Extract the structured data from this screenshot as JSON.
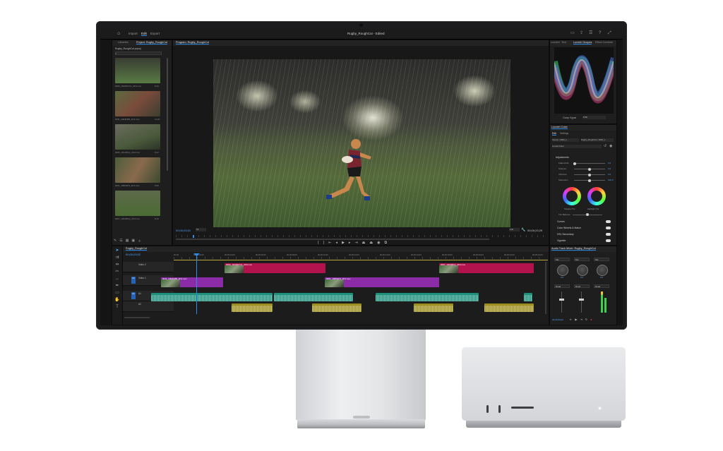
{
  "app": {
    "title": "Rugby_RoughCut - Edited",
    "menu": [
      "Import",
      "Edit",
      "Export"
    ],
    "active_menu": "Edit"
  },
  "project_panel": {
    "tabs": [
      "Libraries",
      "Project: Rugby_RoughCut"
    ],
    "breadcrumb": "Rugby_RoughCut.prproj",
    "clips": [
      {
        "name": "0003_19HM07C1_4K3.mov",
        "duration": "5;24"
      },
      {
        "name": "0011_10EZHB5_4K3.mov",
        "duration": "11;20"
      },
      {
        "name": "0005_15C20KQ_4K3.mov",
        "duration": "6;12"
      },
      {
        "name": "0001_19B7EP3_4K3.mov",
        "duration": "5;06"
      },
      {
        "name": "0007_10D28KQ_4K3.mov",
        "duration": "8;19"
      }
    ]
  },
  "program_monitor": {
    "tab": "Program: Rugby_RoughCut",
    "timecode_in": "00;00;03;02",
    "timecode_out": "00;00;23;29",
    "zoom": "Fit",
    "quality": "Full"
  },
  "timeline": {
    "tab": "Rugby_RoughCut",
    "timecode": "00;00;03;02",
    "ruler": [
      "00;00",
      "00;00;02;00",
      "00;00;04;00",
      "00;00;06;00",
      "00;00;08;00",
      "00;00;10;00",
      "00;00;12;00",
      "00;00;14;00",
      "00;00;16;00",
      "00;00;18;00",
      "00;00;20;00",
      "00;00;22;00",
      "00;00;24;00"
    ],
    "tracks": {
      "v2": "Video 2",
      "v1": "Video 1",
      "a1": "A1",
      "a2": "A2"
    },
    "clips": {
      "v2a": "0003_19HM07C1_4K3.mov",
      "v1a": "0011_10EZHB5_4K3.mov",
      "v1b": "0001_19B7EP3_4K3.mov",
      "v2b": "0007_10D28KQ_4K3.mov"
    }
  },
  "scopes_panel": {
    "tabs": [
      "Lumetri",
      "Text",
      "Lumetri Scopes",
      "Effect Controls"
    ],
    "clamp_label": "Clamp Signal",
    "bit_depth": "8 Bit"
  },
  "lumetri_color": {
    "tab": "Lumetri Color",
    "subtabs": [
      "Edit",
      "Settings"
    ],
    "source": "Source • 0003_1...",
    "target": "Rugby_RoughCut • 0003_1...",
    "preset": "Lumetri Color",
    "adjustments_label": "Adjustments",
    "sliders": [
      {
        "label": "Faded Film",
        "value": "0.0"
      },
      {
        "label": "Sharpen",
        "value": "0.0"
      },
      {
        "label": "Vibrance",
        "value": "0.0"
      },
      {
        "label": "Saturation",
        "value": "100.0"
      }
    ],
    "wheels": [
      "Shadow Tint",
      "Highlight Tint"
    ],
    "tint_balance": "Tint Balance",
    "sections": [
      "Curves",
      "Color Wheels & Match",
      "HSL Secondary",
      "Vignette"
    ]
  },
  "mixer": {
    "tab": "Audio Track Mixer: Rugby_RoughCut",
    "timecode": "00;00;03;02",
    "read_labels": [
      "Read",
      "Read",
      "Read"
    ],
    "knob_values": [
      "0.0",
      "0.0",
      "0.0"
    ],
    "pan_slots": [
      "Mix",
      "Mix",
      "Mix"
    ]
  },
  "colors": {
    "accent_blue": "#2d8ceb",
    "video_clip_red": "#b3134d",
    "video_clip_purple": "#8b2ba8",
    "audio_clip_teal": "#1e8f7a",
    "audio_clip_yellow": "#9c8e1f"
  }
}
